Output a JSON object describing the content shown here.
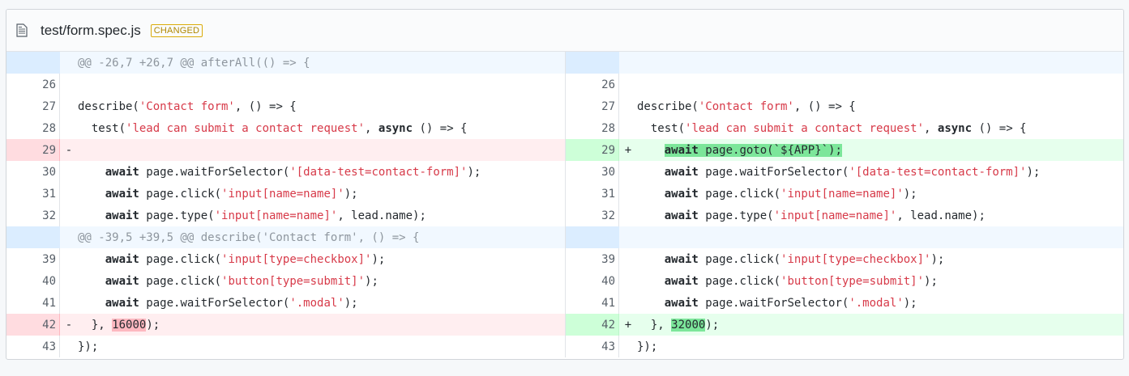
{
  "file": {
    "name": "test/form.spec.js",
    "badge": "CHANGED"
  },
  "left": [
    {
      "type": "hunk",
      "ln": "",
      "mk": "",
      "code": "@@ -26,7 +26,7 @@ afterAll(() => {"
    },
    {
      "type": "ctx",
      "ln": "26",
      "mk": "",
      "code": ""
    },
    {
      "type": "ctx",
      "ln": "27",
      "mk": "",
      "code": "describe('Contact form', () => {"
    },
    {
      "type": "ctx",
      "ln": "28",
      "mk": "",
      "code": "  test('lead can submit a contact request', async () => {"
    },
    {
      "type": "del",
      "ln": "29",
      "mk": "-",
      "code": ""
    },
    {
      "type": "ctx",
      "ln": "30",
      "mk": "",
      "code": "    await page.waitForSelector('[data-test=contact-form]');"
    },
    {
      "type": "ctx",
      "ln": "31",
      "mk": "",
      "code": "    await page.click('input[name=name]');"
    },
    {
      "type": "ctx",
      "ln": "32",
      "mk": "",
      "code": "    await page.type('input[name=name]', lead.name);"
    },
    {
      "type": "hunk",
      "ln": "",
      "mk": "",
      "code": "@@ -39,5 +39,5 @@ describe('Contact form', () => {"
    },
    {
      "type": "ctx",
      "ln": "39",
      "mk": "",
      "code": "    await page.click('input[type=checkbox]');"
    },
    {
      "type": "ctx",
      "ln": "40",
      "mk": "",
      "code": "    await page.click('button[type=submit]');"
    },
    {
      "type": "ctx",
      "ln": "41",
      "mk": "",
      "code": "    await page.waitForSelector('.modal');"
    },
    {
      "type": "del",
      "ln": "42",
      "mk": "-",
      "code": "  }, 16000);"
    },
    {
      "type": "ctx",
      "ln": "43",
      "mk": "",
      "code": "});"
    }
  ],
  "right": [
    {
      "type": "hunk",
      "ln": "",
      "mk": "",
      "code": ""
    },
    {
      "type": "ctx",
      "ln": "26",
      "mk": "",
      "code": ""
    },
    {
      "type": "ctx",
      "ln": "27",
      "mk": "",
      "code": "describe('Contact form', () => {"
    },
    {
      "type": "ctx",
      "ln": "28",
      "mk": "",
      "code": "  test('lead can submit a contact request', async () => {"
    },
    {
      "type": "add",
      "ln": "29",
      "mk": "+",
      "code": "    await page.goto(`${APP}`);"
    },
    {
      "type": "ctx",
      "ln": "30",
      "mk": "",
      "code": "    await page.waitForSelector('[data-test=contact-form]');"
    },
    {
      "type": "ctx",
      "ln": "31",
      "mk": "",
      "code": "    await page.click('input[name=name]');"
    },
    {
      "type": "ctx",
      "ln": "32",
      "mk": "",
      "code": "    await page.type('input[name=name]', lead.name);"
    },
    {
      "type": "hunk",
      "ln": "",
      "mk": "",
      "code": ""
    },
    {
      "type": "ctx",
      "ln": "39",
      "mk": "",
      "code": "    await page.click('input[type=checkbox]');"
    },
    {
      "type": "ctx",
      "ln": "40",
      "mk": "",
      "code": "    await page.click('button[type=submit]');"
    },
    {
      "type": "ctx",
      "ln": "41",
      "mk": "",
      "code": "    await page.waitForSelector('.modal');"
    },
    {
      "type": "add",
      "ln": "42",
      "mk": "+",
      "code": "  }, 32000);"
    },
    {
      "type": "ctx",
      "ln": "43",
      "mk": "",
      "code": "});"
    }
  ]
}
